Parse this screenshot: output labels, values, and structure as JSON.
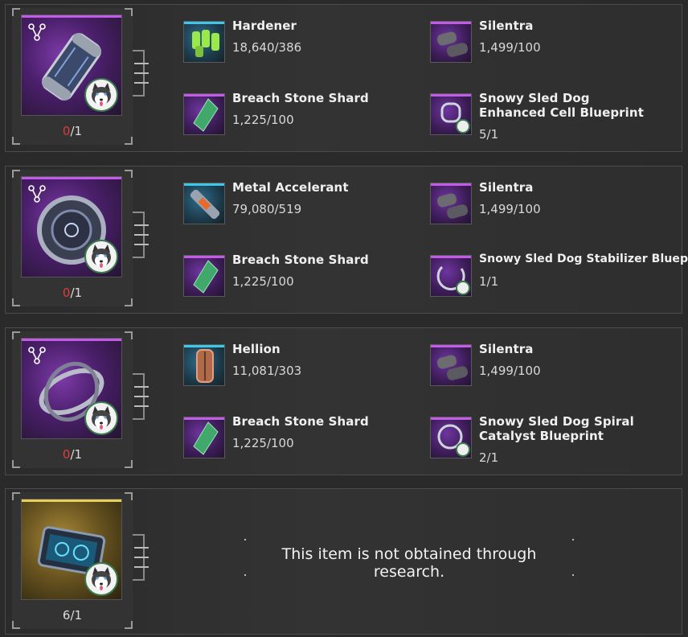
{
  "panels": [
    {
      "item": "cell",
      "count": {
        "current": "0",
        "sep": "/",
        "required": "1"
      },
      "materials": [
        {
          "name": "Hardener",
          "qty": "18,640/386",
          "rarity": "blue",
          "icon": "hardener-icon"
        },
        {
          "name": "Silentra",
          "qty": "1,499/100",
          "rarity": "purple",
          "icon": "silentra-icon"
        },
        {
          "name": "Breach Stone Shard",
          "qty": "1,225/100",
          "rarity": "purple",
          "icon": "breach-stone-shard-icon"
        },
        {
          "name": "Snowy Sled Dog Enhanced Cell Blueprint",
          "qty": "5/1",
          "rarity": "purple",
          "icon": "blueprint-icon"
        }
      ]
    },
    {
      "item": "stabilizer",
      "count": {
        "current": "0",
        "sep": "/",
        "required": "1"
      },
      "materials": [
        {
          "name": "Metal Accelerant",
          "qty": "79,080/519",
          "rarity": "blue",
          "icon": "metal-accelerant-icon"
        },
        {
          "name": "Silentra",
          "qty": "1,499/100",
          "rarity": "purple",
          "icon": "silentra-icon"
        },
        {
          "name": "Breach Stone Shard",
          "qty": "1,225/100",
          "rarity": "purple",
          "icon": "breach-stone-shard-icon"
        },
        {
          "name": "Snowy Sled Dog Stabilizer Blueprint",
          "qty": "1/1",
          "rarity": "purple",
          "icon": "blueprint-icon"
        }
      ]
    },
    {
      "item": "spiral-catalyst",
      "count": {
        "current": "0",
        "sep": "/",
        "required": "1"
      },
      "materials": [
        {
          "name": "Hellion",
          "qty": "11,081/303",
          "rarity": "blue",
          "icon": "hellion-icon"
        },
        {
          "name": "Silentra",
          "qty": "1,499/100",
          "rarity": "purple",
          "icon": "silentra-icon"
        },
        {
          "name": "Breach Stone Shard",
          "qty": "1,225/100",
          "rarity": "purple",
          "icon": "breach-stone-shard-icon"
        },
        {
          "name": "Snowy Sled Dog Spiral Catalyst Blueprint",
          "qty": "2/1",
          "rarity": "purple",
          "icon": "blueprint-icon"
        }
      ]
    },
    {
      "item": "code",
      "count": {
        "current": "6",
        "sep": "/",
        "required": "1"
      },
      "notice": "This item is not obtained through research."
    }
  ],
  "colors": {
    "purple_rarity": "#c25be8",
    "blue_rarity": "#3ec7e8",
    "gold_rarity": "#e6d25a",
    "insufficient": "#e03a3a"
  }
}
